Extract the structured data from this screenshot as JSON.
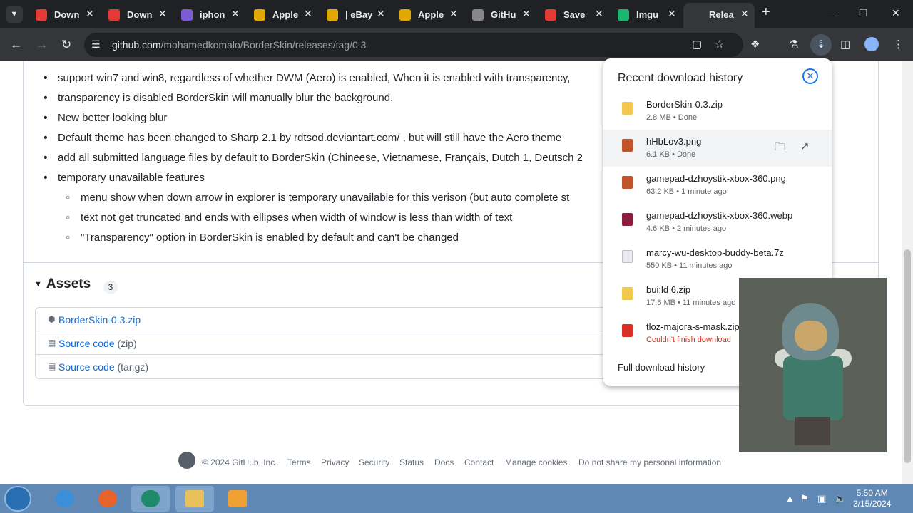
{
  "tabs": [
    {
      "title": "Down",
      "fav": "#e53935"
    },
    {
      "title": "Down",
      "fav": "#e53935"
    },
    {
      "title": "iphon",
      "fav": "#7b5cd6"
    },
    {
      "title": "Apple",
      "fav": "#e0a800"
    },
    {
      "title": "| eBay",
      "fav": "#e0a800"
    },
    {
      "title": "Apple",
      "fav": "#e0a800"
    },
    {
      "title": "GitHu",
      "fav": "#888888"
    },
    {
      "title": "Save",
      "fav": "#e53935"
    },
    {
      "title": "Imgu",
      "fav": "#1bb76e"
    },
    {
      "title": "Relea",
      "fav": "#35363a"
    }
  ],
  "toolbar": {
    "url_host": "github.com",
    "url_path": "/mohamedkomalo/BorderSkin/releases/tag/0.3"
  },
  "notes": {
    "items": [
      "support win7 and win8, regardless of whether DWM (Aero) is enabled, When it is enabled with transparency,",
      "transparency is disabled BorderSkin will manually blur the background.",
      "New better looking blur",
      "Default theme has been changed to Sharp 2.1 by rdtsod.deviantart.com/ , but will still have the Aero theme",
      "add all submitted language files by default to BorderSkin (Chineese, Vietnamese, Français, Dutch 1, Deutsch 2",
      "temporary unavailable features"
    ],
    "sub_items": [
      "menu show when down arrow in explorer is temporary unavailable for this verison (but auto complete st",
      "text not get truncated and ends with ellipses when width of window is less than width of text",
      "\"Transparency\" option in BorderSkin is enabled by default and can't be changed"
    ]
  },
  "assets": {
    "title": "Assets",
    "count": "3",
    "rows": [
      {
        "name": "BorderSkin-0.3.zip",
        "ext": ""
      },
      {
        "name": "Source code",
        "ext": "(zip)"
      },
      {
        "name": "Source code",
        "ext": "(tar.gz)"
      }
    ]
  },
  "footer": {
    "copyright": "© 2024 GitHub, Inc.",
    "links": [
      "Terms",
      "Privacy",
      "Security",
      "Status",
      "Docs",
      "Contact",
      "Manage cookies",
      "Do not share my personal information"
    ]
  },
  "downloads": {
    "title": "Recent download history",
    "items": [
      {
        "name": "BorderSkin-0.3.zip",
        "meta": "2.8 MB • Done",
        "icon": "zip-icon",
        "color": "#f2c94c"
      },
      {
        "name": "hHbLov3.png",
        "meta": "6.1 KB • Done",
        "icon": "image-icon",
        "color": "#c0542a"
      },
      {
        "name": "gamepad-dzhoystik-xbox-360.png",
        "meta": "63.2 KB • 1 minute ago",
        "icon": "image-icon",
        "color": "#c0542a"
      },
      {
        "name": "gamepad-dzhoystik-xbox-360.webp",
        "meta": "4.6 KB • 2 minutes ago",
        "icon": "webp-icon",
        "color": "#8b1e3f"
      },
      {
        "name": "marcy-wu-desktop-buddy-beta.7z",
        "meta": "550 KB • 11 minutes ago",
        "icon": "file-icon",
        "color": "#e8eaed"
      },
      {
        "name": "bui;ld 6.zip",
        "meta": "17.6 MB • 11 minutes ago",
        "icon": "zip-icon",
        "color": "#f2c94c"
      },
      {
        "name": "tloz-majora-s-mask.zip",
        "meta": "Couldn't finish download",
        "icon": "failed-icon",
        "color": "#d93025",
        "error": true
      }
    ],
    "full_history": "Full download history"
  },
  "taskbar": {
    "time": "5:50 AM",
    "date": "3/15/2024"
  }
}
